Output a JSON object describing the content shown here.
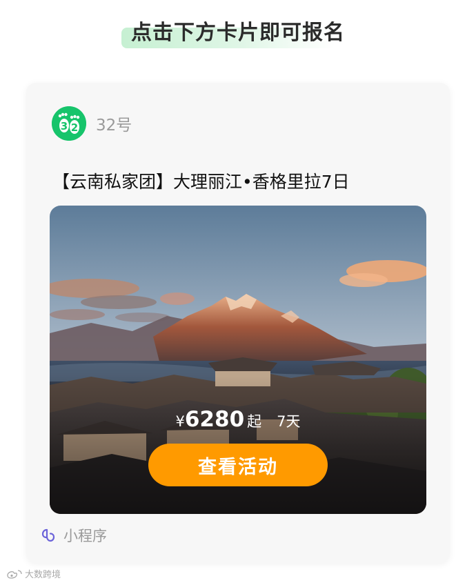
{
  "headline": "点击下方卡片即可报名",
  "account": {
    "name": "32号",
    "avatar_text": "32"
  },
  "card": {
    "title": "【云南私家团】大理丽江•香格里拉7日",
    "price": {
      "currency": "¥",
      "value": "6280",
      "unit": "起",
      "days": "7天"
    },
    "cta_label": "查看活动"
  },
  "footer": {
    "label": "小程序"
  },
  "watermark": "大数跨境",
  "colors": {
    "brand_green": "#17c46b",
    "cta_orange": "#ff9a00",
    "mini_program_purple": "#6b63d9"
  }
}
